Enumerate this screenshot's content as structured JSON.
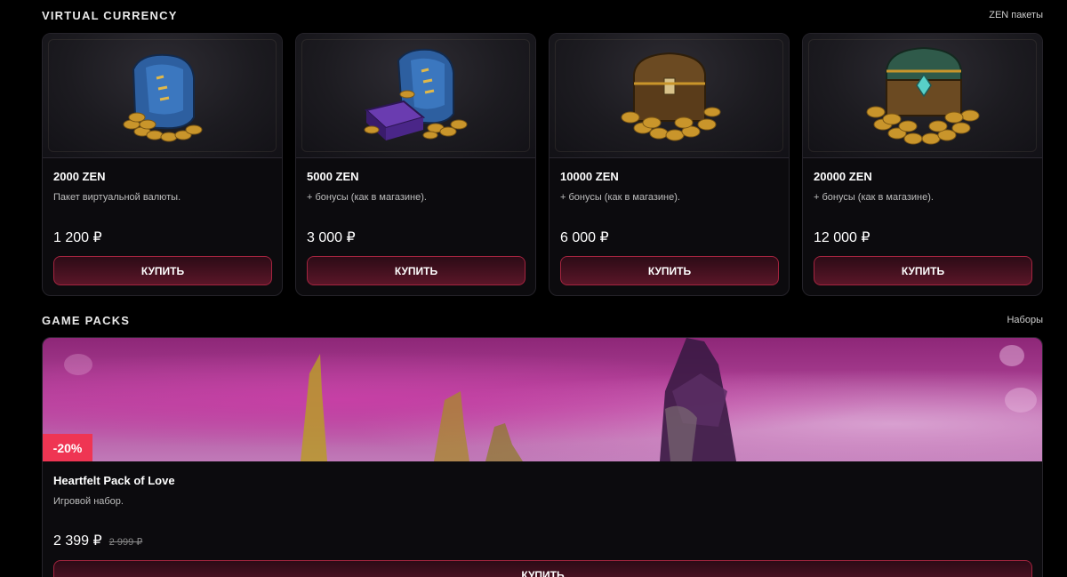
{
  "virtual_currency": {
    "title": "VIRTUAL CURRENCY",
    "link": "ZEN пакеты",
    "items": [
      {
        "name": "2000 ZEN",
        "description": "Пакет виртуальной валюты.",
        "price": "1 200 ₽",
        "button": "КУПИТЬ",
        "image": "zen-bag-icon"
      },
      {
        "name": "5000 ZEN",
        "description": "+ бонусы (как в магазине).",
        "price": "3 000 ₽",
        "button": "КУПИТЬ",
        "image": "zen-bag-box-icon"
      },
      {
        "name": "10000 ZEN",
        "description": "+ бонусы (как в магазине).",
        "price": "6 000 ₽",
        "button": "КУПИТЬ",
        "image": "zen-chest-icon"
      },
      {
        "name": "20000 ZEN",
        "description": "+ бонусы (как в магазине).",
        "price": "12 000 ₽",
        "button": "КУПИТЬ",
        "image": "zen-jewel-chest-icon"
      }
    ]
  },
  "game_packs": {
    "title": "GAME PACKS",
    "link": "Наборы",
    "items": [
      {
        "name": "Heartfelt Pack of Love",
        "description": "Игровой набор.",
        "price": "2 399 ₽",
        "old_price": "2 999 ₽",
        "discount": "-20%",
        "button": "КУПИТЬ"
      }
    ]
  },
  "colors": {
    "background": "#000000",
    "card": "#0c0b0e",
    "button_border": "#a4243f",
    "button_fill": "#5a1628",
    "discount": "#ef3553",
    "coin_gold": "#c9952b"
  }
}
